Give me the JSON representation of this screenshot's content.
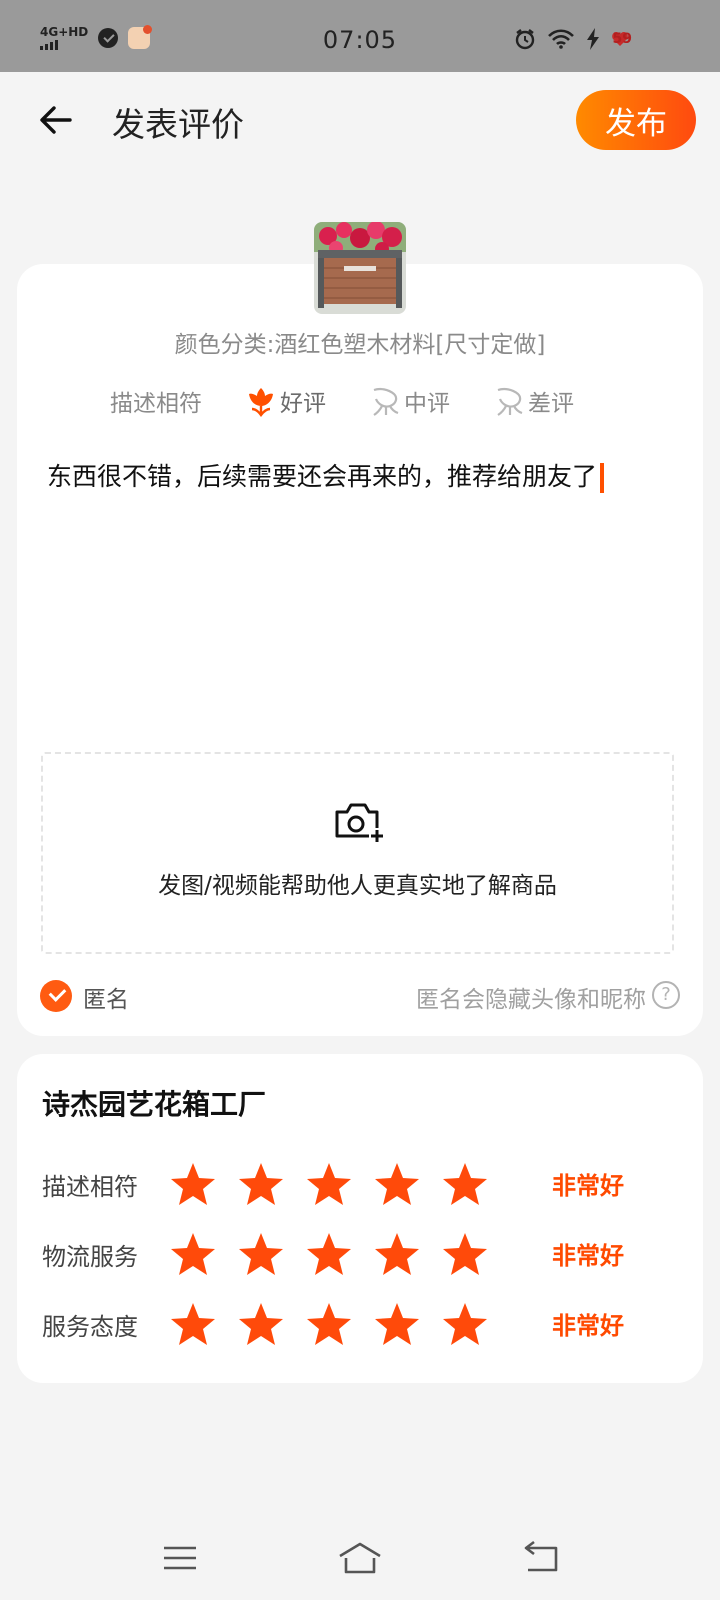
{
  "status_bar": {
    "network": "4G+HD",
    "time": "07:05",
    "battery": "59"
  },
  "header": {
    "title": "发表评价",
    "publish_label": "发布"
  },
  "product": {
    "sku": "颜色分类:酒红色塑木材料[尺寸定做]"
  },
  "rating": {
    "label": "描述相符",
    "options": [
      "好评",
      "中评",
      "差评"
    ],
    "selected": "好评"
  },
  "review": {
    "text": "东西很不错，后续需要还会再来的，推荐给朋友了"
  },
  "upload": {
    "hint": "发图/视频能帮助他人更真实地了解商品"
  },
  "anonymous": {
    "label": "匿名",
    "hint": "匿名会隐藏头像和昵称",
    "checked": true
  },
  "shop": {
    "name": "诗杰园艺花箱工厂",
    "scores": [
      {
        "label": "描述相符",
        "stars": 5,
        "text": "非常好"
      },
      {
        "label": "物流服务",
        "stars": 5,
        "text": "非常好"
      },
      {
        "label": "服务态度",
        "stars": 5,
        "text": "非常好"
      }
    ]
  },
  "colors": {
    "accent": "#ff5000",
    "gradient_start": "#ff8a00",
    "gradient_end": "#ff4a0f",
    "background": "#f4f4f4"
  }
}
